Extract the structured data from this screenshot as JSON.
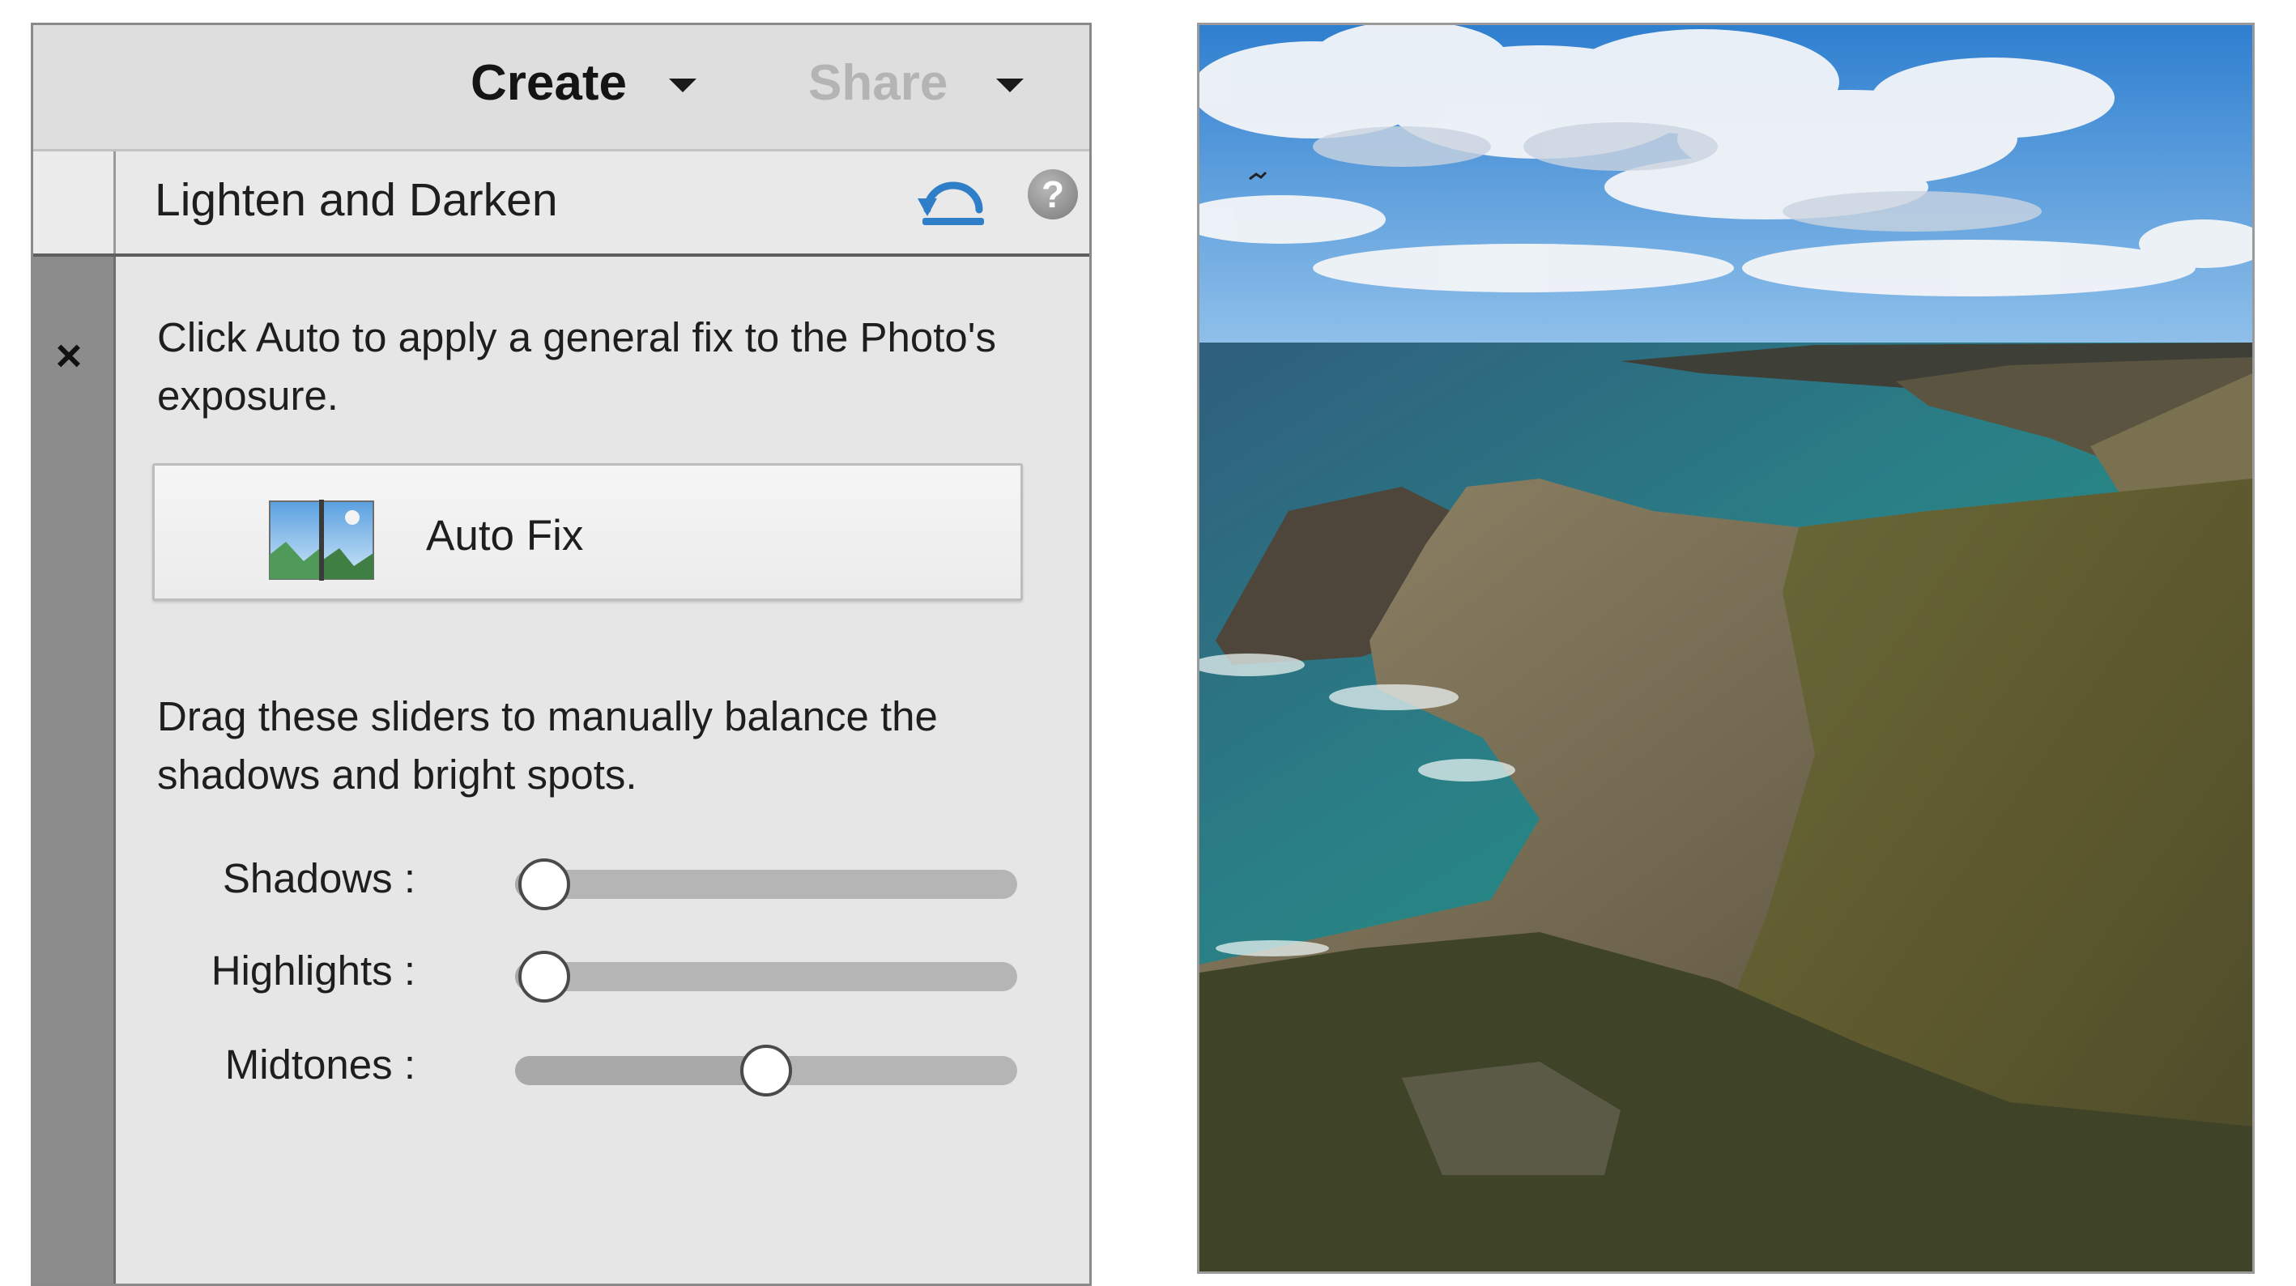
{
  "toolbar": {
    "create_label": "Create",
    "share_label": "Share"
  },
  "panel": {
    "title": "Lighten and Darken",
    "reset_icon": "reset-undo-icon",
    "help_icon_text": "?",
    "close_icon_text": "×",
    "auto_description": "Click Auto to apply a general fix to the Photo's exposure.",
    "auto_fix_label": "Auto Fix",
    "slider_description": "Drag these sliders to manually balance the shadows and bright spots.",
    "sliders": [
      {
        "label": "Shadows :",
        "value": 0
      },
      {
        "label": "Highlights :",
        "value": 0
      },
      {
        "label": "Midtones :",
        "value": 0.5
      }
    ]
  },
  "photo": {
    "icon": "coastal-cliff-photo"
  },
  "colors": {
    "accent_blue": "#2f7fc8",
    "sea_green": "#1f8f7a",
    "sky_blue": "#3e8fd6"
  }
}
